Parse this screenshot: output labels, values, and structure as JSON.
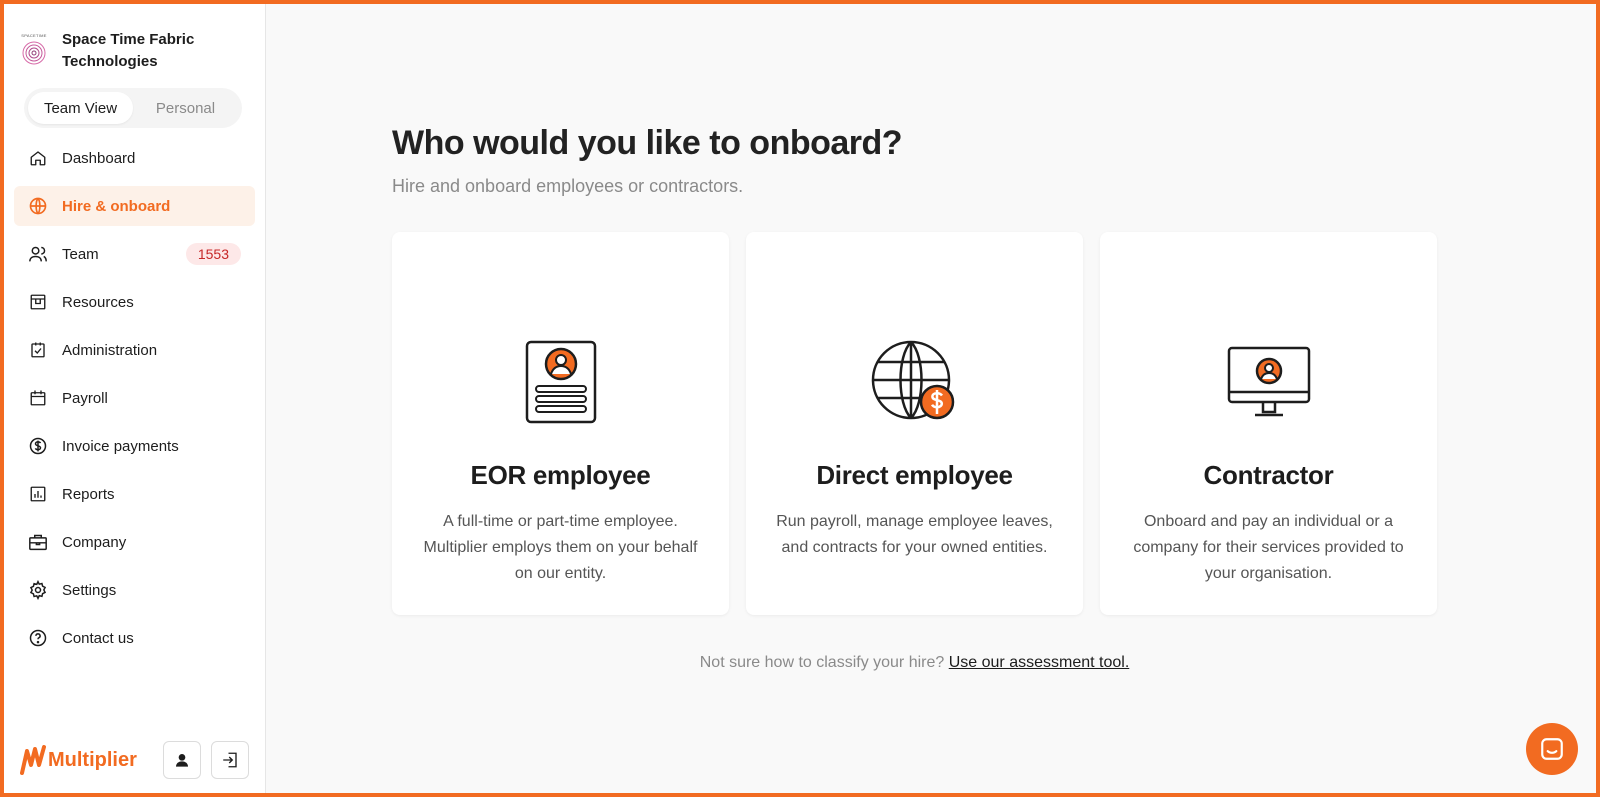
{
  "company": {
    "name": "Space Time Fabric Technologies",
    "logo_text": "SPACETIME"
  },
  "view_toggle": {
    "team": "Team View",
    "personal": "Personal",
    "selected": "Team View"
  },
  "sidebar": {
    "items": [
      {
        "label": "Dashboard",
        "icon": "home-icon"
      },
      {
        "label": "Hire & onboard",
        "icon": "globe-icon",
        "active": true
      },
      {
        "label": "Team",
        "icon": "users-icon",
        "badge": "1553"
      },
      {
        "label": "Resources",
        "icon": "resources-icon"
      },
      {
        "label": "Administration",
        "icon": "clipboard-check-icon"
      },
      {
        "label": "Payroll",
        "icon": "calendar-icon"
      },
      {
        "label": "Invoice payments",
        "icon": "dollar-circle-icon"
      },
      {
        "label": "Reports",
        "icon": "bar-chart-icon"
      },
      {
        "label": "Company",
        "icon": "briefcase-icon"
      },
      {
        "label": "Settings",
        "icon": "gear-icon"
      },
      {
        "label": "Contact us",
        "icon": "question-circle-icon"
      }
    ]
  },
  "footer": {
    "brand": "Multiplier",
    "profile_icon": "user-icon",
    "logout_icon": "logout-icon"
  },
  "main": {
    "heading": "Who would you like to onboard?",
    "subheading": "Hire and onboard employees or contractors.",
    "cards": [
      {
        "title": "EOR employee",
        "description": "A full-time or part-time employee. Multiplier employs them on your behalf on our entity.",
        "icon": "id-document-icon"
      },
      {
        "title": "Direct employee",
        "description": "Run payroll, manage employee leaves, and contracts for your owned entities.",
        "icon": "globe-dollar-icon"
      },
      {
        "title": "Contractor",
        "description": "Onboard and pay an individual or a company for their services provided to your organisation.",
        "icon": "monitor-user-icon"
      }
    ],
    "help_text": "Not sure how to classify your hire?",
    "help_link": "Use our assessment tool."
  },
  "colors": {
    "accent": "#f26b21",
    "active_bg": "#fdf1e8",
    "badge_bg": "#fde8e8",
    "badge_text": "#c62828"
  },
  "chat_icon": "chat-icon"
}
